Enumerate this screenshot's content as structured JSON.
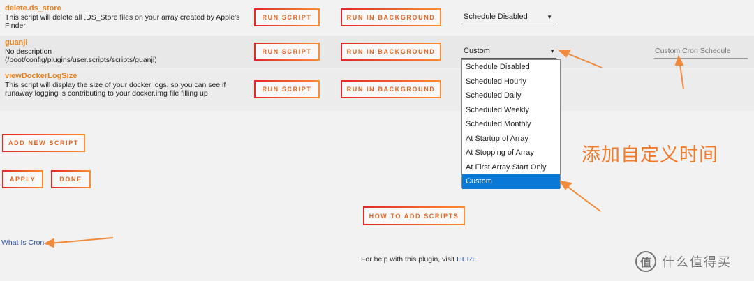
{
  "scripts": [
    {
      "name": "delete.ds_store",
      "desc_lines": [
        "This script will delete all .DS_Store files on your array created by Apple's",
        "Finder"
      ],
      "run_label": "RUN SCRIPT",
      "bg_label": "RUN IN BACKGROUND",
      "schedule": "Schedule Disabled"
    },
    {
      "name": "guanji",
      "desc_lines": [
        "No description",
        "(/boot/config/plugins/user.scripts/scripts/guanji)"
      ],
      "run_label": "RUN SCRIPT",
      "bg_label": "RUN IN BACKGROUND",
      "schedule": "Custom",
      "cron_placeholder": "Custom Cron Schedule"
    },
    {
      "name": "viewDockerLogSize",
      "desc_lines": [
        "This script will display the size of your docker logs, so you can see if",
        "runaway logging is contributing to your docker.img file filling up"
      ],
      "run_label": "RUN SCRIPT",
      "bg_label": "RUN IN BACKGROUND"
    }
  ],
  "caret": "▼",
  "dropdown_options": [
    "Schedule Disabled",
    "Scheduled Hourly",
    "Scheduled Daily",
    "Scheduled Weekly",
    "Scheduled Monthly",
    "At Startup of Array",
    "At Stopping of Array",
    "At First Array Start Only",
    "Custom"
  ],
  "dropdown_selected_index": 8,
  "buttons": {
    "add_new": "ADD NEW SCRIPT",
    "apply": "APPLY",
    "done": "DONE",
    "how_to": "HOW TO ADD SCRIPTS"
  },
  "links": {
    "what_is_cron": "What Is Cron"
  },
  "help": {
    "text": "For help with this plugin, visit",
    "link": "HERE"
  },
  "annotation": "添加自定义时间",
  "watermark": {
    "glyph": "值",
    "text": "什么值得买"
  },
  "colors": {
    "accent": "#e77e1b",
    "button_border": "#e2561d",
    "selected": "#0a78d7",
    "arrow": "#f08a3c"
  }
}
